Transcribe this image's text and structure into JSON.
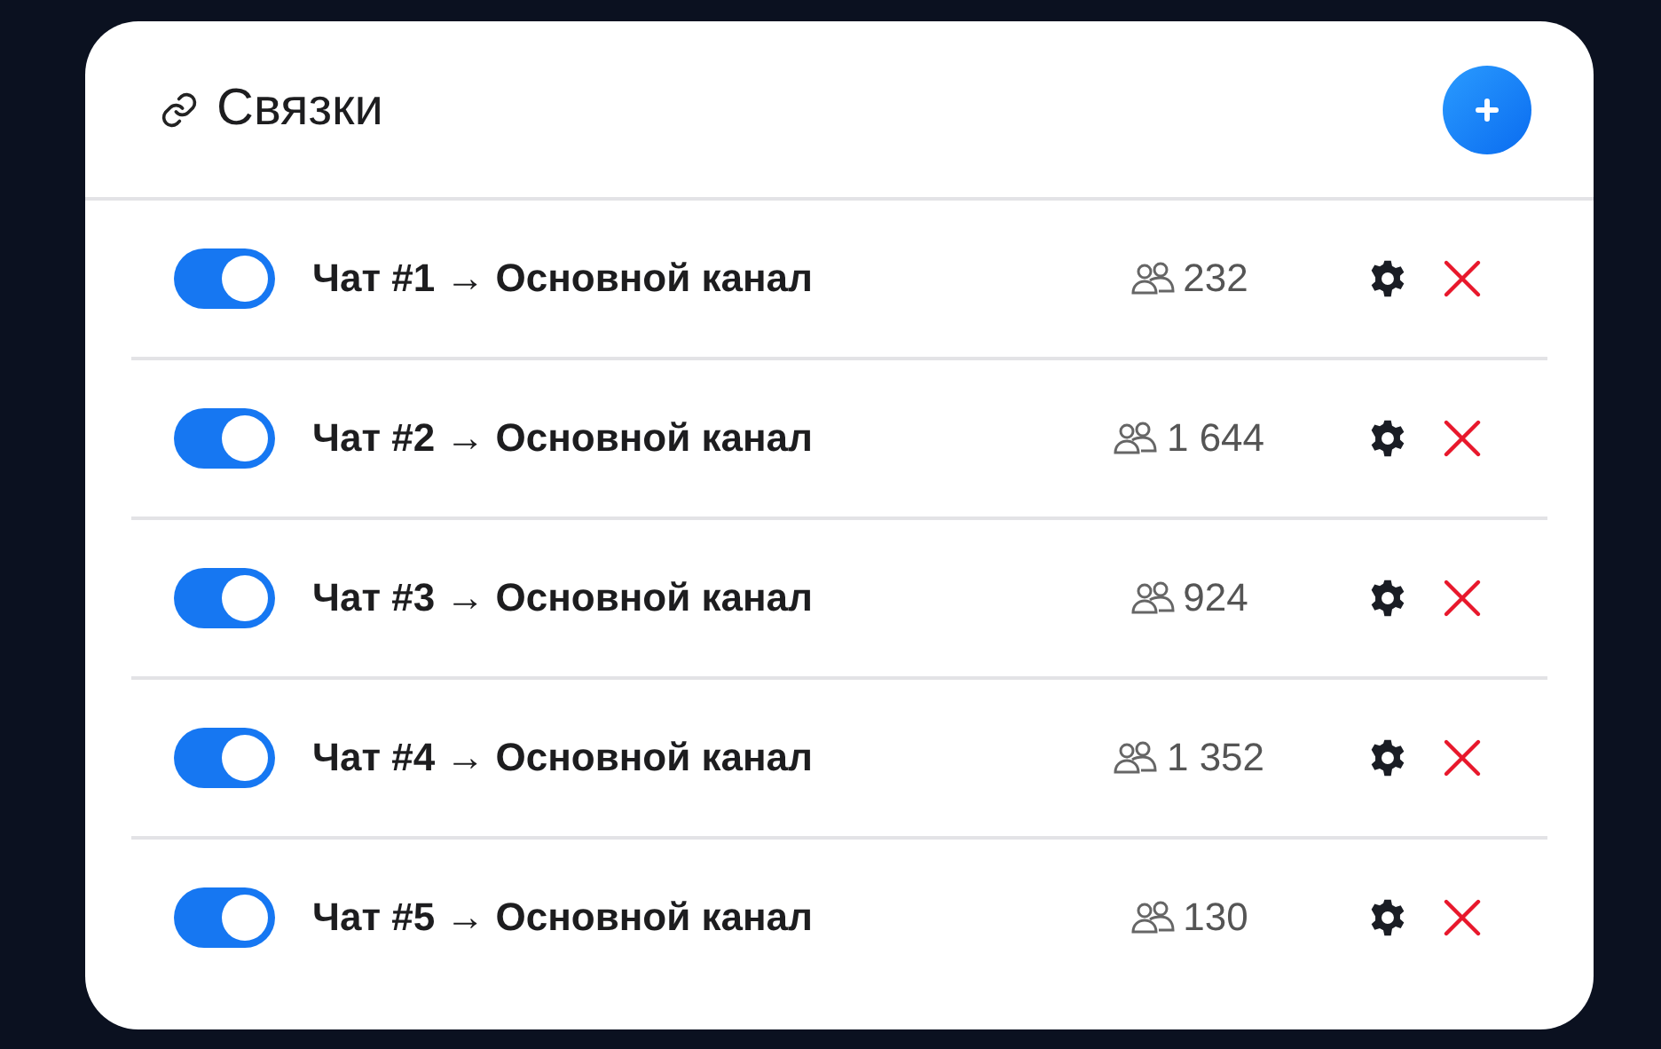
{
  "title": "Связки",
  "links": [
    {
      "label": "Чат #1 → Основной канал",
      "on": true,
      "count": "232"
    },
    {
      "label": "Чат #2 → Основной канал",
      "on": true,
      "count": "1 644"
    },
    {
      "label": "Чат #3 → Основной канал",
      "on": true,
      "count": "924"
    },
    {
      "label": "Чат #4 → Основной канал",
      "on": true,
      "count": "1 352"
    },
    {
      "label": "Чат #5 → Основной канал",
      "on": true,
      "count": "130"
    }
  ]
}
